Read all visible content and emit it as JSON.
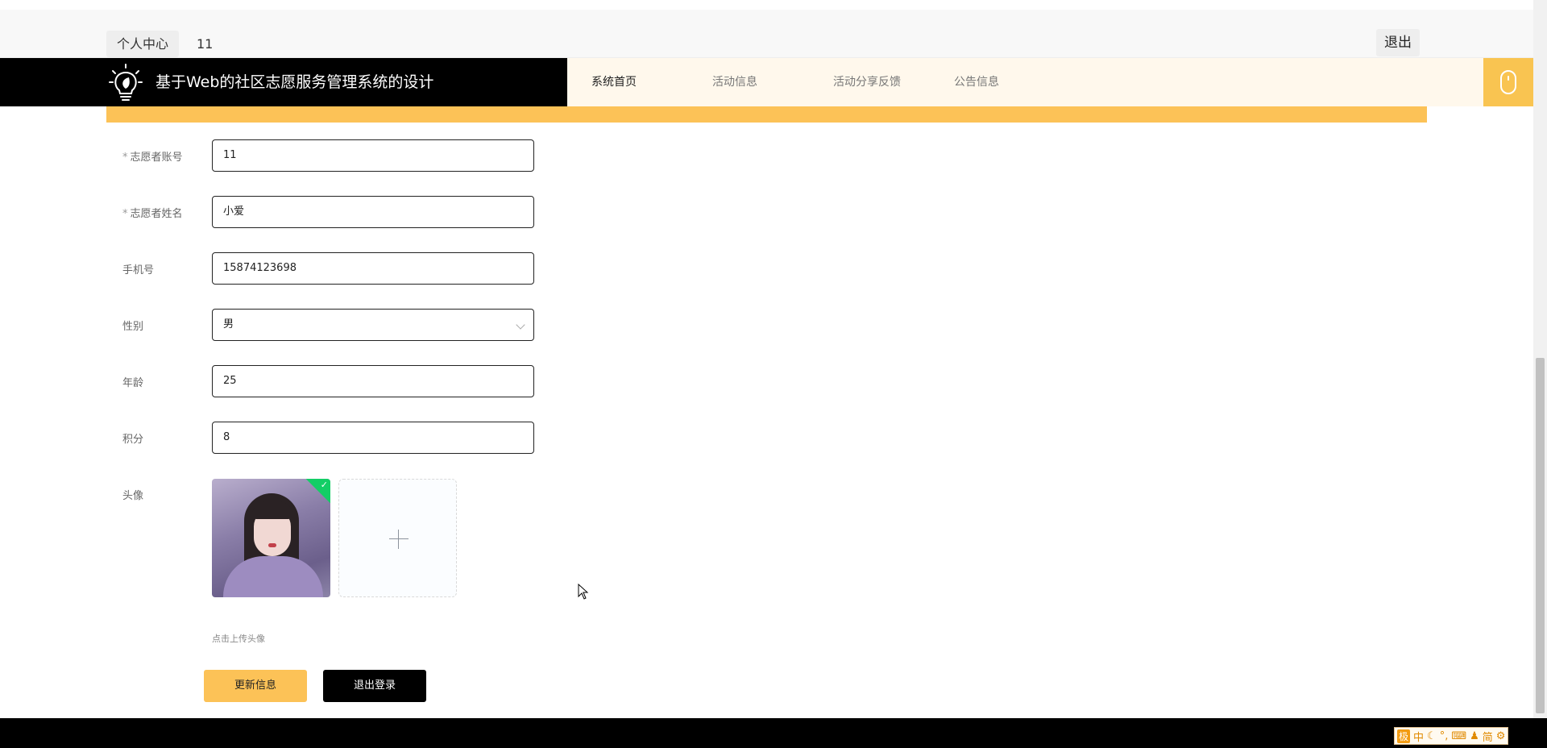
{
  "top_bar": {
    "personal_center_label": "个人中心",
    "username": "11",
    "logout_label": "退出"
  },
  "header": {
    "site_title": "基于Web的社区志愿服务管理系统的设计",
    "nav": [
      {
        "label": "系统首页",
        "active": true
      },
      {
        "label": "活动信息",
        "active": false
      },
      {
        "label": "活动分享反馈",
        "active": false
      },
      {
        "label": "公告信息",
        "active": false
      }
    ],
    "icons": {
      "logo": "lightbulb-leaf-icon",
      "mouse": "mouse-icon"
    }
  },
  "form": {
    "account": {
      "label": "志愿者账号",
      "required_mark": "*",
      "value": "11"
    },
    "name": {
      "label": "志愿者姓名",
      "required_mark": "*",
      "value": "小爱"
    },
    "phone": {
      "label": "手机号",
      "value": "15874123698"
    },
    "gender": {
      "label": "性别",
      "value": "男"
    },
    "age": {
      "label": "年龄",
      "value": "25"
    },
    "points": {
      "label": "积分",
      "value": "8"
    },
    "avatar": {
      "label": "头像",
      "upload_hint": "点击上传头像"
    }
  },
  "actions": {
    "update_label": "更新信息",
    "logout_label": "退出登录"
  },
  "ime": {
    "logo": "极",
    "mode": "中",
    "simplified": "简"
  },
  "colors": {
    "accent": "#fcc257",
    "header_dark": "#000000",
    "success": "#13ce66"
  }
}
